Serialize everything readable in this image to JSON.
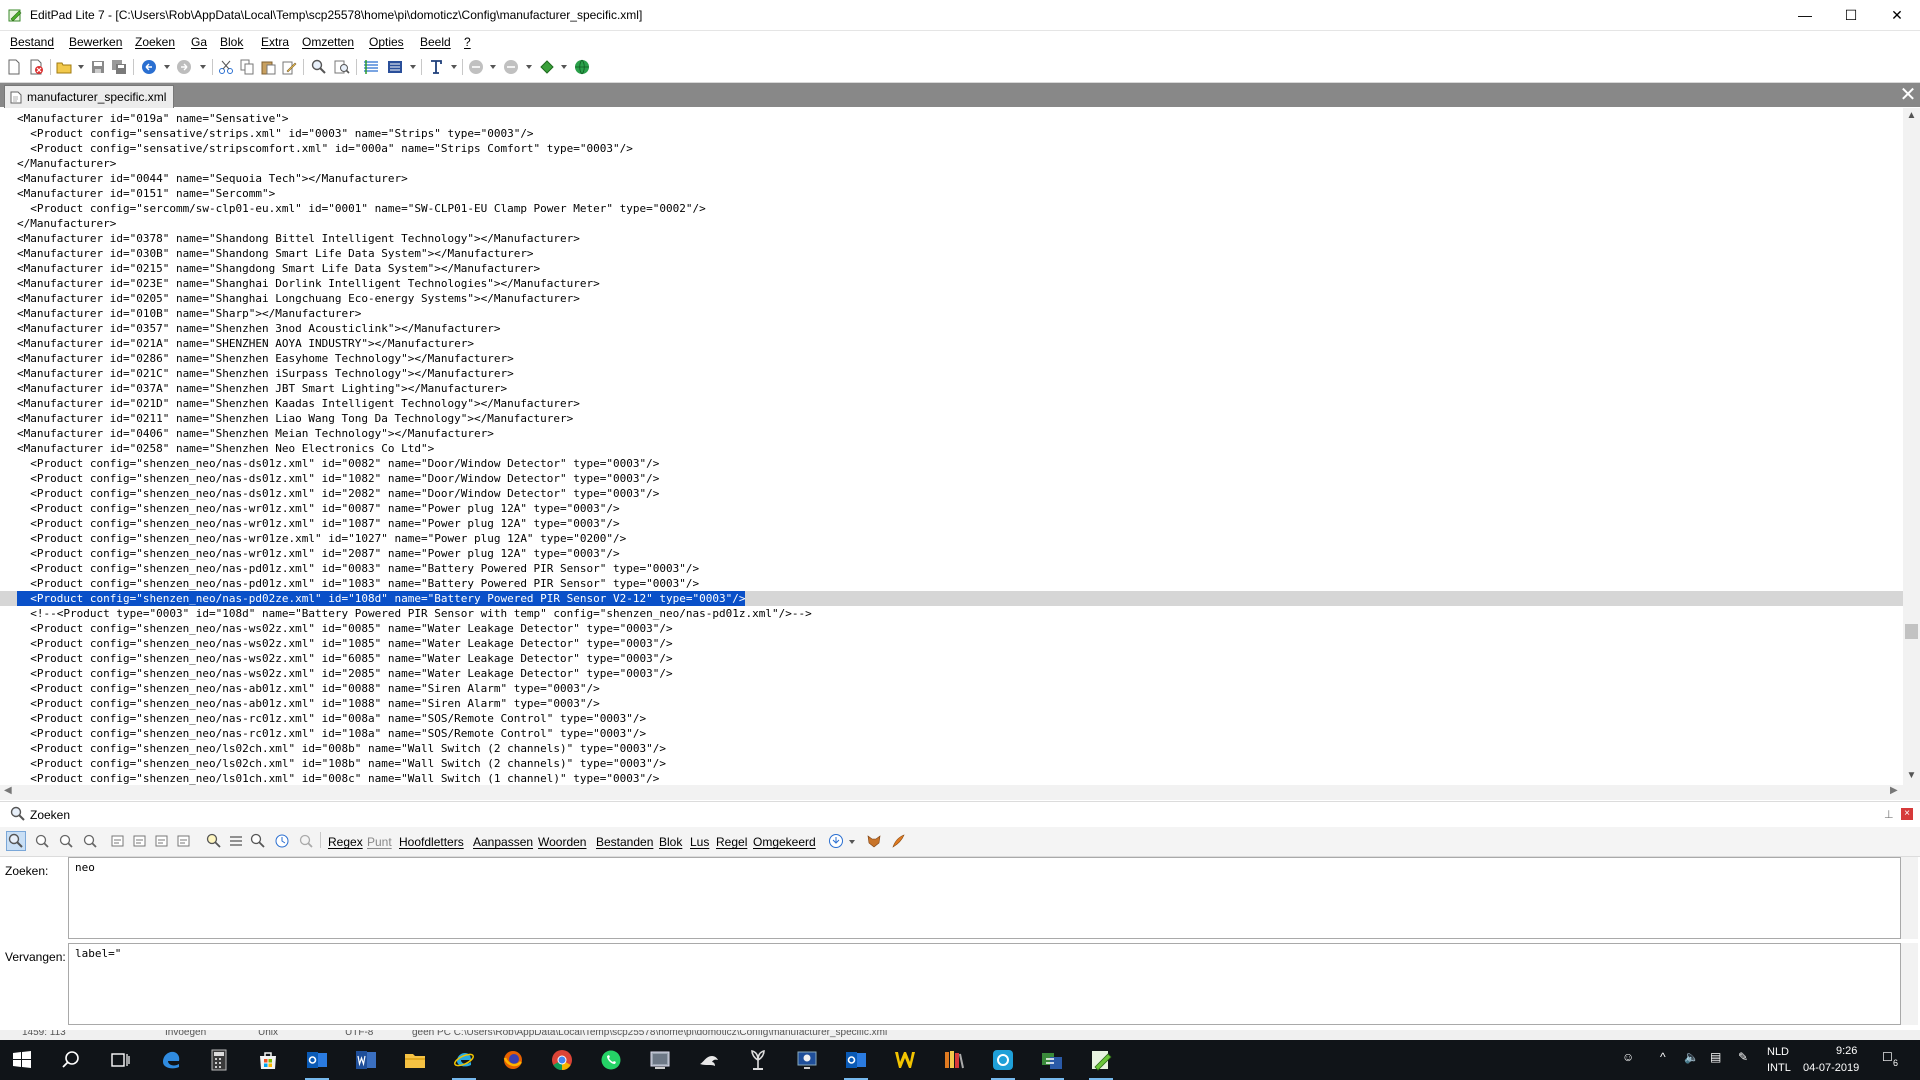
{
  "window": {
    "title": "EditPad Lite 7 - [C:\\Users\\Rob\\AppData\\Local\\Temp\\scp25578\\home\\pi\\domoticz\\Config\\manufacturer_specific.xml]",
    "minimize": "—",
    "maximize": "☐",
    "close": "✕"
  },
  "menu": [
    "Bestand",
    "Bewerken",
    "Zoeken",
    "Ga",
    "Blok",
    "Extra",
    "Omzetten",
    "Opties",
    "Beeld",
    "?"
  ],
  "tab": {
    "label": "manufacturer_specific.xml",
    "close": "✕"
  },
  "editor": {
    "lines": [
      "<Manufacturer id=\"019a\" name=\"Sensative\">",
      "  <Product config=\"sensative/strips.xml\" id=\"0003\" name=\"Strips\" type=\"0003\"/>",
      "  <Product config=\"sensative/stripscomfort.xml\" id=\"000a\" name=\"Strips Comfort\" type=\"0003\"/>",
      "</Manufacturer>",
      "<Manufacturer id=\"0044\" name=\"Sequoia Tech\"></Manufacturer>",
      "<Manufacturer id=\"0151\" name=\"Sercomm\">",
      "  <Product config=\"sercomm/sw-clp01-eu.xml\" id=\"0001\" name=\"SW-CLP01-EU Clamp Power Meter\" type=\"0002\"/>",
      "</Manufacturer>",
      "<Manufacturer id=\"0378\" name=\"Shandong Bittel Intelligent Technology\"></Manufacturer>",
      "<Manufacturer id=\"030B\" name=\"Shandong Smart Life Data System\"></Manufacturer>",
      "<Manufacturer id=\"0215\" name=\"Shangdong Smart Life Data System\"></Manufacturer>",
      "<Manufacturer id=\"023E\" name=\"Shanghai Dorlink Intelligent Technologies\"></Manufacturer>",
      "<Manufacturer id=\"0205\" name=\"Shanghai Longchuang Eco-energy Systems\"></Manufacturer>",
      "<Manufacturer id=\"010B\" name=\"Sharp\"></Manufacturer>",
      "<Manufacturer id=\"0357\" name=\"Shenzhen 3nod Acousticlink\"></Manufacturer>",
      "<Manufacturer id=\"021A\" name=\"SHENZHEN AOYA INDUSTRY\"></Manufacturer>",
      "<Manufacturer id=\"0286\" name=\"Shenzhen Easyhome Technology\"></Manufacturer>",
      "<Manufacturer id=\"021C\" name=\"Shenzhen iSurpass Technology\"></Manufacturer>",
      "<Manufacturer id=\"037A\" name=\"Shenzhen JBT Smart Lighting\"></Manufacturer>",
      "<Manufacturer id=\"021D\" name=\"Shenzhen Kaadas Intelligent Technology\"></Manufacturer>",
      "<Manufacturer id=\"0211\" name=\"Shenzhen Liao Wang Tong Da Technology\"></Manufacturer>",
      "<Manufacturer id=\"0406\" name=\"Shenzhen Meian Technology\"></Manufacturer>",
      "<Manufacturer id=\"0258\" name=\"Shenzhen Neo Electronics Co Ltd\">",
      "  <Product config=\"shenzen_neo/nas-ds01z.xml\" id=\"0082\" name=\"Door/Window Detector\" type=\"0003\"/>",
      "  <Product config=\"shenzen_neo/nas-ds01z.xml\" id=\"1082\" name=\"Door/Window Detector\" type=\"0003\"/>",
      "  <Product config=\"shenzen_neo/nas-ds01z.xml\" id=\"2082\" name=\"Door/Window Detector\" type=\"0003\"/>",
      "  <Product config=\"shenzen_neo/nas-wr01z.xml\" id=\"0087\" name=\"Power plug 12A\" type=\"0003\"/>",
      "  <Product config=\"shenzen_neo/nas-wr01z.xml\" id=\"1087\" name=\"Power plug 12A\" type=\"0003\"/>",
      "  <Product config=\"shenzen_neo/nas-wr01ze.xml\" id=\"1027\" name=\"Power plug 12A\" type=\"0200\"/>",
      "  <Product config=\"shenzen_neo/nas-wr01z.xml\" id=\"2087\" name=\"Power plug 12A\" type=\"0003\"/>",
      "  <Product config=\"shenzen_neo/nas-pd01z.xml\" id=\"0083\" name=\"Battery Powered PIR Sensor\" type=\"0003\"/>",
      "  <Product config=\"shenzen_neo/nas-pd01z.xml\" id=\"1083\" name=\"Battery Powered PIR Sensor\" type=\"0003\"/>",
      "  <Product config=\"shenzen_neo/nas-pd02ze.xml\" id=\"108d\" name=\"Battery Powered PIR Sensor V2-12\" type=\"0003\"/>",
      "  <!--<Product type=\"0003\" id=\"108d\" name=\"Battery Powered PIR Sensor with temp\" config=\"shenzen_neo/nas-pd01z.xml\"/>-->",
      "  <Product config=\"shenzen_neo/nas-ws02z.xml\" id=\"0085\" name=\"Water Leakage Detector\" type=\"0003\"/>",
      "  <Product config=\"shenzen_neo/nas-ws02z.xml\" id=\"1085\" name=\"Water Leakage Detector\" type=\"0003\"/>",
      "  <Product config=\"shenzen_neo/nas-ws02z.xml\" id=\"6085\" name=\"Water Leakage Detector\" type=\"0003\"/>",
      "  <Product config=\"shenzen_neo/nas-ws02z.xml\" id=\"2085\" name=\"Water Leakage Detector\" type=\"0003\"/>",
      "  <Product config=\"shenzen_neo/nas-ab01z.xml\" id=\"0088\" name=\"Siren Alarm\" type=\"0003\"/>",
      "  <Product config=\"shenzen_neo/nas-ab01z.xml\" id=\"1088\" name=\"Siren Alarm\" type=\"0003\"/>",
      "  <Product config=\"shenzen_neo/nas-rc01z.xml\" id=\"008a\" name=\"SOS/Remote Control\" type=\"0003\"/>",
      "  <Product config=\"shenzen_neo/nas-rc01z.xml\" id=\"108a\" name=\"SOS/Remote Control\" type=\"0003\"/>",
      "  <Product config=\"shenzen_neo/ls02ch.xml\" id=\"008b\" name=\"Wall Switch (2 channels)\" type=\"0003\"/>",
      "  <Product config=\"shenzen_neo/ls02ch.xml\" id=\"108b\" name=\"Wall Switch (2 channels)\" type=\"0003\"/>",
      "  <Product config=\"shenzen_neo/ls01ch.xml\" id=\"008c\" name=\"Wall Switch (1 channel)\" type=\"0003\"/>"
    ],
    "selected_line_index": 32
  },
  "search": {
    "panel_title": "Zoeken",
    "options": [
      {
        "label": "Regex",
        "dim": false
      },
      {
        "label": "Punt",
        "dim": true
      },
      {
        "label": "Hoofdletters",
        "dim": false
      },
      {
        "label": "Aanpassen",
        "dim": false
      },
      {
        "label": "Woorden",
        "dim": false
      },
      {
        "label": "Bestanden",
        "dim": false
      },
      {
        "label": "Blok",
        "dim": false
      },
      {
        "label": "Lus",
        "dim": false
      },
      {
        "label": "Regel",
        "dim": false
      },
      {
        "label": "Omgekeerd",
        "dim": false
      }
    ],
    "find_label": "Zoeken:",
    "find_value": "neo",
    "replace_label": "Vervangen:",
    "replace_value": "label=\""
  },
  "status": {
    "position": "1459: 113",
    "mode": "Invoegen",
    "line_endings": "Unix",
    "encoding": "UTF-8",
    "path": "geen PC C:\\Users\\Rob\\AppData\\Local\\Temp\\scp25578\\home\\pi\\domoticz\\Config\\manufacturer_specific.xml"
  },
  "taskbar": {
    "language": "NLD",
    "keyboard": "INTL",
    "time": "9:26",
    "date": "04-07-2019",
    "notifications": "6"
  },
  "colors": {
    "selection": "#0a50c8",
    "tabbar": "#888888",
    "taskbar": "#101418"
  }
}
